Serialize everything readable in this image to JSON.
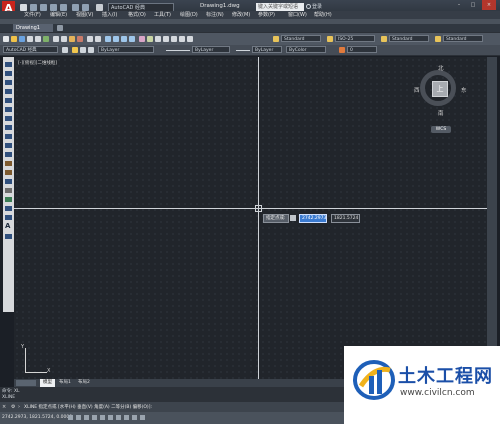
{
  "title_bar": {
    "workspace": "AutoCAD 经典",
    "document": "Drawing1.dwg",
    "search_placeholder": "键入关键字或短语",
    "sign_in": "登录"
  },
  "menu": [
    "文件(F)",
    "编辑(E)",
    "视图(V)",
    "插入(I)",
    "格式(O)",
    "工具(T)",
    "绘图(D)",
    "标注(N)",
    "修改(M)",
    "参数(P)",
    "窗口(W)",
    "帮助(H)"
  ],
  "tabs": {
    "document_tab": "Drawing1"
  },
  "toolbar": {
    "workspace_combo": "AutoCAD 经典",
    "layer_combo": "ByLayer",
    "linetype_combo": "ByLayer",
    "lineweight_combo": "ByLayer",
    "color_combo": "ByColor",
    "text_style": "Standard",
    "dim_style": "ISO-25",
    "table_style": "Standard",
    "mleader_style": "Standard",
    "layer_current": "0"
  },
  "viewport": {
    "label": "[-][俯视][二维线框]",
    "compass": {
      "north": "北",
      "south": "南",
      "east": "东",
      "west": "西"
    },
    "cube_face": "上",
    "wcs": "WCS"
  },
  "dynamic_input": {
    "prompt": "指定点或:",
    "x_value": "2742.2973",
    "y_value": "1821.5724"
  },
  "ucs": {
    "x": "X",
    "y": "Y"
  },
  "layout_tabs": [
    "模型",
    "布局1",
    "布局2"
  ],
  "command_history": [
    "命令: XL",
    "XLINE"
  ],
  "command_prompt": "XLINE 指定点或 [水平(H) 垂直(V) 角度(A) 二等分(B) 偏移(O)]:",
  "status_bar": {
    "coords": "2742.2973, 1821.5724, 0.0000"
  },
  "watermark": {
    "title": "土木工程网",
    "url": "www.civilcn.com"
  },
  "colors": {
    "canvas": "#21252b",
    "crosshair": "#cfd3d8",
    "highlight": "#3b7bd1",
    "app_red": "#c8241c"
  }
}
